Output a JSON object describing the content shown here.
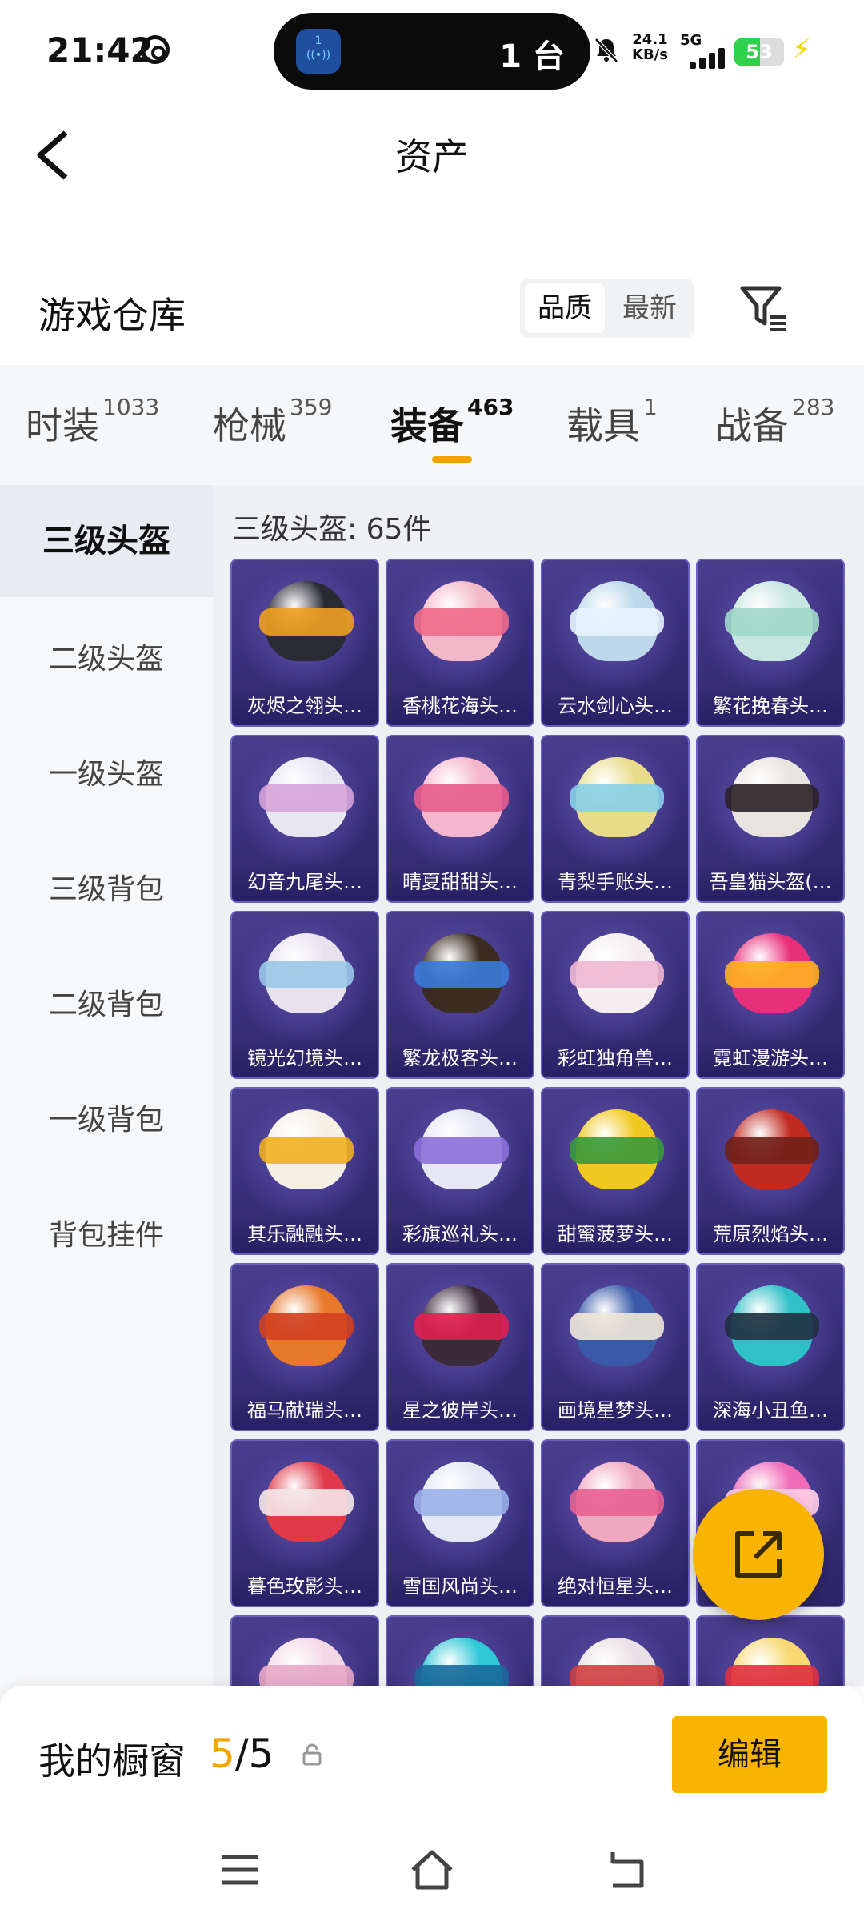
{
  "status_bar": {
    "time": "21:42",
    "island_text": "1 台",
    "island_app_label": "1",
    "speed_value": "24.1",
    "speed_unit": "KB/s",
    "network": "5G",
    "battery": "53"
  },
  "header": {
    "title": "资产"
  },
  "warehouse": {
    "title": "游戏仓库",
    "sort_quality": "品质",
    "sort_latest": "最新"
  },
  "tabs": [
    {
      "label": "时装",
      "count": "1033"
    },
    {
      "label": "枪械",
      "count": "359"
    },
    {
      "label": "装备",
      "count": "463"
    },
    {
      "label": "载具",
      "count": "1"
    },
    {
      "label": "战备",
      "count": "283"
    }
  ],
  "sidebar": {
    "items": [
      {
        "label": "三级头盔"
      },
      {
        "label": "二级头盔"
      },
      {
        "label": "一级头盔"
      },
      {
        "label": "三级背包"
      },
      {
        "label": "二级背包"
      },
      {
        "label": "一级背包"
      },
      {
        "label": "背包挂件"
      }
    ]
  },
  "grid": {
    "count_label": "三级头盔: 65件",
    "items": [
      {
        "name": "灰烬之翎头…",
        "color": "#2a2a35",
        "accent": "#f0a020"
      },
      {
        "name": "香桃花海头…",
        "color": "#f2b8c8",
        "accent": "#f06a8a"
      },
      {
        "name": "云水剑心头…",
        "color": "#bcd8ea",
        "accent": "#e8f4ff"
      },
      {
        "name": "繁花挽春头…",
        "color": "#c8e6e0",
        "accent": "#a0d8c8"
      },
      {
        "name": "幻音九尾头…",
        "color": "#e8e6f2",
        "accent": "#d7a3d9"
      },
      {
        "name": "晴夏甜甜头…",
        "color": "#f4b6cc",
        "accent": "#e85c8c"
      },
      {
        "name": "青梨手账头…",
        "color": "#e8dc8a",
        "accent": "#88d0e8"
      },
      {
        "name": "吾皇猫头盔(…",
        "color": "#e8e4e0",
        "accent": "#2a2226"
      },
      {
        "name": "镜光幻境头…",
        "color": "#e8e2ee",
        "accent": "#9ac8e8"
      },
      {
        "name": "繁龙极客头…",
        "color": "#3a2c20",
        "accent": "#3a7ad8"
      },
      {
        "name": "彩虹独角兽…",
        "color": "#f4eef0",
        "accent": "#f0b8d0"
      },
      {
        "name": "霓虹漫游头…",
        "color": "#e8307a",
        "accent": "#ffb020"
      },
      {
        "name": "其乐融融头…",
        "color": "#f4f0e4",
        "accent": "#f0b020"
      },
      {
        "name": "彩旗巡礼头…",
        "color": "#e6e6f4",
        "accent": "#8a70d8"
      },
      {
        "name": "甜蜜菠萝头…",
        "color": "#f0c820",
        "accent": "#3a9a3a"
      },
      {
        "name": "荒原烈焰头…",
        "color": "#c02a20",
        "accent": "#702018"
      },
      {
        "name": "福马献瑞头…",
        "color": "#e8782a",
        "accent": "#d04020"
      },
      {
        "name": "星之彼岸头…",
        "color": "#3a2a3a",
        "accent": "#e02050"
      },
      {
        "name": "画境星梦头…",
        "color": "#3a5aa8",
        "accent": "#f0e8d8"
      },
      {
        "name": "深海小丑鱼…",
        "color": "#30c0c8",
        "accent": "#203040"
      },
      {
        "name": "暮色玫影头…",
        "color": "#e03a4a",
        "accent": "#f4e8e8"
      },
      {
        "name": "雪国风尚头…",
        "color": "#e4e8f4",
        "accent": "#9ab0e8"
      },
      {
        "name": "绝对恒星头…",
        "color": "#f0a8c0",
        "accent": "#e86090"
      },
      {
        "name": "",
        "color": "#f06ab8",
        "accent": "#ffd0e8"
      },
      {
        "name": "",
        "color": "#f4d8e4",
        "accent": "#e8a8c8"
      },
      {
        "name": "",
        "color": "#30c8d8",
        "accent": "#1a6a9a"
      },
      {
        "name": "",
        "color": "#e8e0e4",
        "accent": "#d04040"
      },
      {
        "name": "",
        "color": "#f8d870",
        "accent": "#e03040"
      }
    ]
  },
  "bottom": {
    "window_label": "我的橱窗",
    "current": "5",
    "total": "/5",
    "edit_label": "编辑"
  }
}
